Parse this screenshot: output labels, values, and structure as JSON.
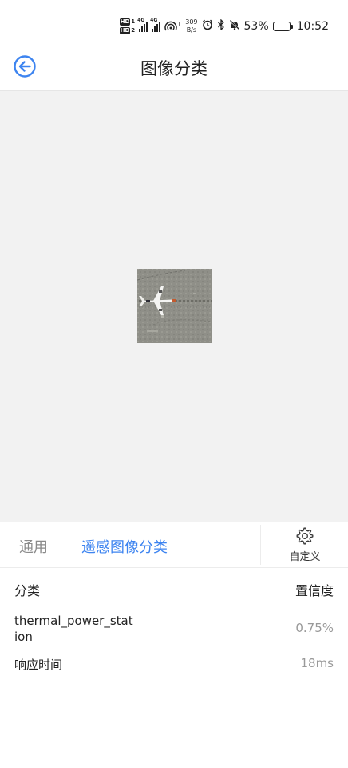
{
  "status_bar": {
    "hd1": "HD",
    "hd1_num": "1",
    "hd2": "HD",
    "hd2_num": "2",
    "sig1_label": "4G",
    "sig2_label": "4G",
    "hotspot_sup": "1",
    "net_speed_value": "309",
    "net_speed_unit": "B/s",
    "battery_text": "53%",
    "battery_level": 0.53,
    "time": "10:52",
    "icons": [
      "alarm-icon",
      "bluetooth-icon",
      "mute-icon",
      "battery-icon"
    ]
  },
  "header": {
    "title": "图像分类",
    "back_icon": "back-arrow-icon",
    "accent_color": "#3d84f0"
  },
  "preview": {
    "image_alt": "airplane on runway (remote sensing image)"
  },
  "tabs": {
    "general": "通用",
    "remote_sensing": "遥感图像分类",
    "active": "remote_sensing",
    "custom_label": "自定义",
    "custom_icon": "gear-icon"
  },
  "results": {
    "col_class": "分类",
    "col_confidence": "置信度",
    "top_class": "thermal_power_station",
    "top_confidence": "0.75%",
    "response_time_label": "响应时间",
    "response_time_value": "18ms"
  }
}
